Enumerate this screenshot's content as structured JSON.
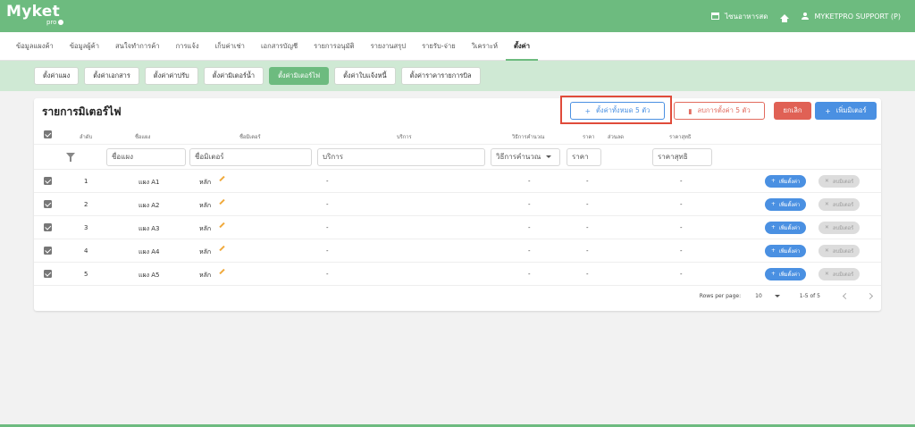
{
  "topbar": {
    "logo": "Myket",
    "logo_sub": "pro",
    "store_name": "ไซนอาหารสด",
    "user": "MYKETPRO SUPPORT (P)"
  },
  "main_nav": [
    {
      "label": "ข้อมูลแผงค้า",
      "active": false
    },
    {
      "label": "ข้อมูลผู้ค้า",
      "active": false
    },
    {
      "label": "สนใจทำการค้า",
      "active": false
    },
    {
      "label": "การแจ้ง",
      "active": false
    },
    {
      "label": "เก็บค่าเช่า",
      "active": false
    },
    {
      "label": "เอกสารบัญชี",
      "active": false
    },
    {
      "label": "รายการอนุมัติ",
      "active": false
    },
    {
      "label": "รายงานสรุป",
      "active": false
    },
    {
      "label": "รายรับ-จ่าย",
      "active": false
    },
    {
      "label": "วิเคราะห์",
      "active": false
    },
    {
      "label": "ตั้งค่า",
      "active": true
    }
  ],
  "sub_nav": [
    {
      "label": "ตั้งค่าแผง",
      "active": false
    },
    {
      "label": "ตั้งค่าเอกสาร",
      "active": false
    },
    {
      "label": "ตั้งค่าค่าปรับ",
      "active": false
    },
    {
      "label": "ตั้งค่ามิเตอร์น้ำ",
      "active": false
    },
    {
      "label": "ตั้งค่ามิเตอร์ไฟ",
      "active": true
    },
    {
      "label": "ตั้งค่าใบแจ้งหนี้",
      "active": false
    },
    {
      "label": "ตั้งค่าราคารายการบิล",
      "active": false
    }
  ],
  "page": {
    "title": "รายการมิเตอร์ไฟ",
    "btn_set_all": "ตั้งค่าทั้งหมด 5 ตัว",
    "btn_delete_settings": "ลบการตั้งค่า 5 ตัว",
    "btn_cancel": "ยกเลิก",
    "btn_add_meter": "เพิ่มมิเตอร์"
  },
  "table": {
    "headers": {
      "index": "ลำดับ",
      "stall": "ชื่อแผง",
      "meter": "ชื่อมิเตอร์",
      "service": "บริการ",
      "calc": "วิธีการคำนวณ",
      "price": "ราคา",
      "discount": "ส่วนลด",
      "net": "ราคาสุทธิ"
    },
    "filters": {
      "stall": "ชื่อแผง",
      "meter": "ชื่อมิเตอร์",
      "service": "บริการ",
      "calc": "วิธีการคำนวณ",
      "price": "ราคา",
      "net": "ราคาสุทธิ"
    },
    "rows": [
      {
        "index": "1",
        "stall": "แผง A1",
        "meter": "หลัก",
        "service": "-",
        "calc": "-",
        "price": "-",
        "net": "-",
        "add_label": "เพิ่มตั้งค่า",
        "del_label": "ลบมิเตอร์"
      },
      {
        "index": "2",
        "stall": "แผง A2",
        "meter": "หลัก",
        "service": "-",
        "calc": "-",
        "price": "-",
        "net": "-",
        "add_label": "เพิ่มตั้งค่า",
        "del_label": "ลบมิเตอร์"
      },
      {
        "index": "3",
        "stall": "แผง A3",
        "meter": "หลัก",
        "service": "-",
        "calc": "-",
        "price": "-",
        "net": "-",
        "add_label": "เพิ่มตั้งค่า",
        "del_label": "ลบมิเตอร์"
      },
      {
        "index": "4",
        "stall": "แผง A4",
        "meter": "หลัก",
        "service": "-",
        "calc": "-",
        "price": "-",
        "net": "-",
        "add_label": "เพิ่มตั้งค่า",
        "del_label": "ลบมิเตอร์"
      },
      {
        "index": "5",
        "stall": "แผง A5",
        "meter": "หลัก",
        "service": "-",
        "calc": "-",
        "price": "-",
        "net": "-",
        "add_label": "เพิ่มตั้งค่า",
        "del_label": "ลบมิเตอร์"
      }
    ]
  },
  "pagination": {
    "rows_per_page_label": "Rows per page:",
    "rows_per_page": "10",
    "range": "1-5 of 5"
  }
}
